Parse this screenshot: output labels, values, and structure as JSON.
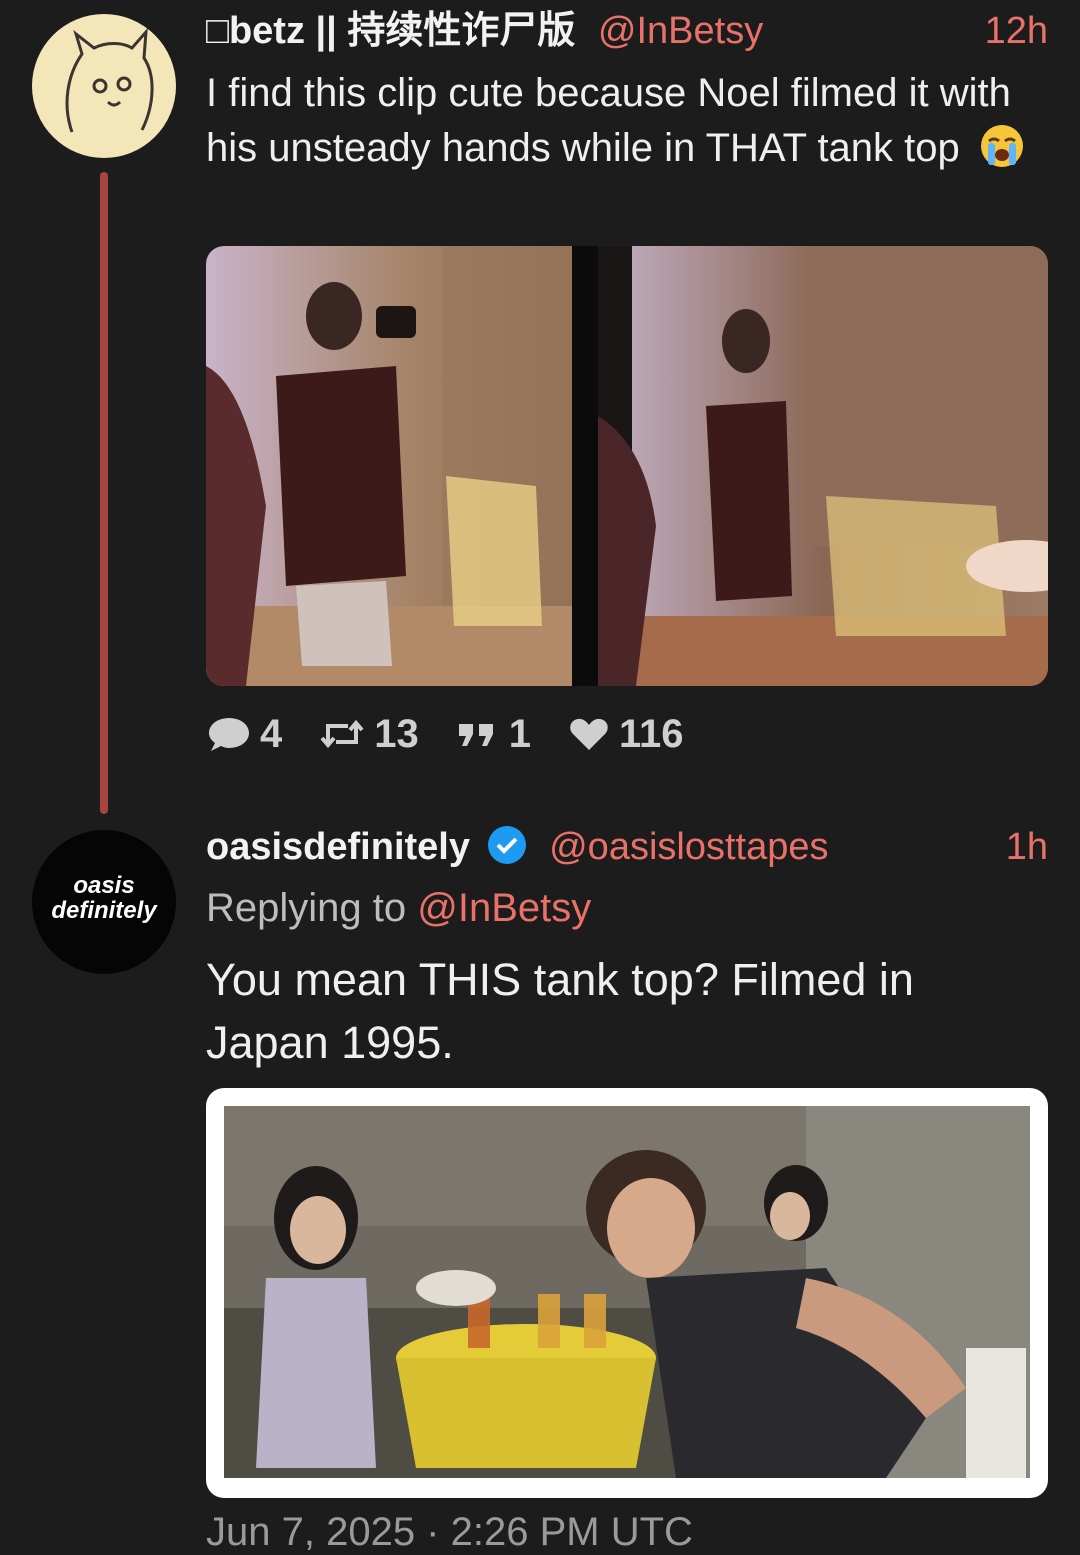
{
  "tweet1": {
    "display_name": "□betz || 持续性诈尸版",
    "handle": "@InBetsy",
    "time": "12h",
    "text": "I find this clip cute because Noel filmed it with his unsteady hands while in THAT tank top",
    "emoji": "loudly-crying-face-icon",
    "media_description": "two video stills of a man holding a camcorder",
    "counts": {
      "replies": "4",
      "retweets": "13",
      "quotes": "1",
      "likes": "116"
    }
  },
  "tweet2": {
    "display_name": "oasisdefinitely",
    "avatar_text": "oasis definitely",
    "handle": "@oasislosttapes",
    "time": "1h",
    "replying_prefix": "Replying to",
    "replying_handle": "@InBetsy",
    "text": "You mean THIS tank top? Filmed in Japan 1995.",
    "media_description": "photo at an outdoor cafe table with beers",
    "timestamp_partial": "Jun 7, 2025 · 2:26 PM UTC"
  },
  "colors": {
    "background": "#1c1c1c",
    "accent": "#e8716a",
    "thread_line": "#a8453f",
    "verified": "#1d9bf0"
  }
}
